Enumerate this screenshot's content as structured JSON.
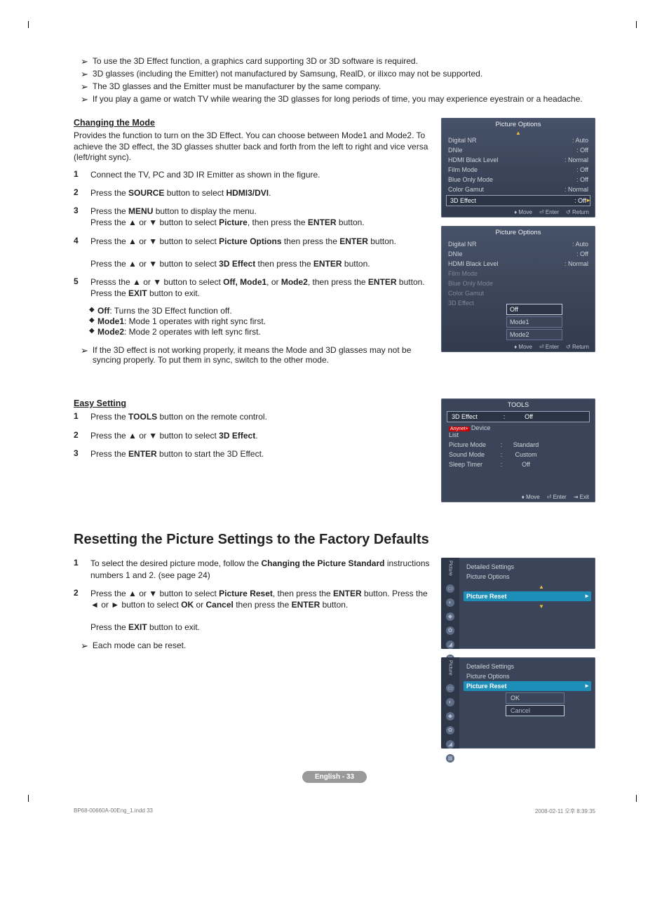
{
  "notes": [
    "To use the 3D Effect function, a graphics card supporting 3D or 3D software is required.",
    "3D glasses (including the Emitter) not manufactured by Samsung, RealD, or ilixco may not be supported.",
    "The 3D glasses and the Emitter must be manufacturer by the same company.",
    "If you play a game or watch TV while wearing the 3D glasses for long periods of time, you may experience eyestrain or a headache."
  ],
  "section1": {
    "heading": "Changing the Mode",
    "intro": "Provides the function to turn on the 3D Effect. You can choose between Mode1 and Mode2. To achieve the 3D effect, the 3D glasses shutter back and forth from the left to right and vice versa (left/right sync).",
    "steps": [
      "Connect the TV, PC and 3D IR Emitter as shown in the figure.",
      "Press the <b>SOURCE</b> button to select <b>HDMI3/DVI</b>.",
      "Press the <b>MENU</b> button to display the menu.<br>Press the ▲ or ▼ button to select <b>Picture</b>, then press the <b>ENTER</b> button.",
      "Press the ▲ or ▼ button to select <b>Picture Options</b> then press the <b>ENTER</b> button.<br><br>Press the ▲ or ▼ button to select <b>3D Effect</b> then press the <b>ENTER</b> button.",
      "Presss the ▲ or ▼ button to select <b>Off, Mode1</b>, or <b>Mode2</b>, then press the <b>ENTER</b> button.<br>Press the <b>EXIT</b> button to exit."
    ],
    "modes": [
      "<b>Off</b>: Turns the 3D Effect function off.",
      "<b>Mode1</b>: Mode 1 operates with right sync first.",
      "<b>Mode2</b>: Mode 2 operates with left sync first."
    ],
    "warn": "If the 3D effect is not working properly, it means the Mode and 3D glasses may not be syncing properly. To put them in sync, switch to the other mode."
  },
  "section2": {
    "heading": "Easy Setting",
    "steps": [
      "Press the <b>TOOLS</b> button on the remote control.",
      "Press the ▲ or ▼ button to select <b>3D Effect</b>.",
      "Press the <b>ENTER</b> button to start the 3D Effect."
    ]
  },
  "section3": {
    "heading": "Resetting the Picture Settings to the Factory Defaults",
    "steps": [
      "To select the desired picture mode, follow the <b>Changing the Picture Standard</b> instructions numbers 1 and 2. (see page 24)",
      "Press the ▲ or ▼ button to select <b>Picture Reset</b>, then press the <b>ENTER</b> button. Press the ◄ or ► button to select <b>OK</b> or <b>Cancel</b> then press the <b>ENTER</b> button.<br><br>Press the <b>EXIT</b> button to exit."
    ],
    "note": "Each mode can be reset."
  },
  "osd1": {
    "title": "Picture Options",
    "rows": [
      {
        "l": "Digital NR",
        "r": ": Auto"
      },
      {
        "l": "DNIe",
        "r": ": Off"
      },
      {
        "l": "HDMI Black Level",
        "r": ": Normal"
      },
      {
        "l": "Film Mode",
        "r": ": Off"
      },
      {
        "l": "Blue Only Mode",
        "r": ": Off"
      },
      {
        "l": "Color Gamut",
        "r": ": Normal"
      },
      {
        "l": "3D Effect",
        "r": ": Off",
        "sel": true
      }
    ],
    "foot": [
      "Move",
      "Enter",
      "Return"
    ]
  },
  "osd2": {
    "title": "Picture Options",
    "rows": [
      {
        "l": "Digital NR",
        "r": ": Auto"
      },
      {
        "l": "DNIe",
        "r": ": Off"
      },
      {
        "l": "HDMI Black Level",
        "r": ": Normal"
      },
      {
        "l": "Film Mode",
        "r": ""
      },
      {
        "l": "Blue Only Mode",
        "r": ""
      },
      {
        "l": "Color Gamut",
        "r": ""
      },
      {
        "l": "3D Effect",
        "r": ""
      }
    ],
    "submenu": [
      "Off",
      "Mode1",
      "Mode2"
    ],
    "foot": [
      "Move",
      "Enter",
      "Return"
    ]
  },
  "tools": {
    "title": "TOOLS",
    "rows": [
      {
        "l": "3D Effect",
        "c": ":",
        "r": "Off",
        "sel": true
      },
      {
        "l": "Device List",
        "anynet": true
      },
      {
        "l": "Picture Mode",
        "c": ":",
        "r": "Standard"
      },
      {
        "l": "Sound Mode",
        "c": ":",
        "r": "Custom"
      },
      {
        "l": "Sleep Timer",
        "c": ":",
        "r": "Off"
      }
    ],
    "foot": [
      "Move",
      "Enter",
      "Exit"
    ]
  },
  "pic1": {
    "tab": "Picture",
    "items": [
      "Detailed Settings",
      "Picture Options"
    ],
    "sel": "Picture Reset"
  },
  "pic2": {
    "tab": "Picture",
    "items": [
      "Detailed Settings",
      "Picture Options"
    ],
    "sel": "Picture Reset",
    "popup": [
      "OK",
      "Cancel"
    ]
  },
  "pagenum": "English - 33",
  "footer_left": "BP68-00660A-00Eng_1.indd   33",
  "footer_right": "2008-02-11   오후 8:39:35"
}
